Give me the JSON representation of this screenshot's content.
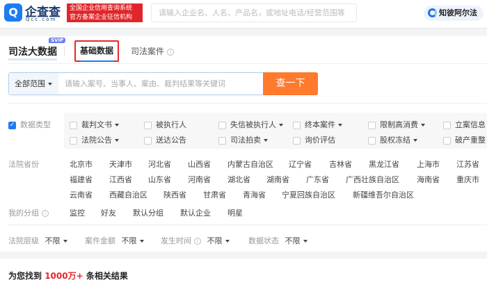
{
  "header": {
    "logo_icon": "qcc-logo-icon",
    "logo_text": "企查查",
    "logo_sub": "Qcc.com",
    "badge_line1": "全国企业信用查询系统",
    "badge_line2": "官方备案企业征信机构",
    "search_placeholder": "请输入企业名、人名、产品名，或地址电话/经营范围等",
    "ai_label": "知彼阿尔法"
  },
  "page": {
    "title": "司法大数据",
    "svip": "SVIP",
    "tabs": [
      {
        "label": "基础数据"
      },
      {
        "label": "司法案件"
      }
    ]
  },
  "search": {
    "scope": "全部范围",
    "placeholder": "请输入案号、当事人、案由、裁判结果等关键词",
    "button": "查一下"
  },
  "filters": {
    "data_type_label": "数据类型",
    "data_types": [
      {
        "label": "裁判文书",
        "dropdown": true
      },
      {
        "label": "被执行人",
        "dropdown": false
      },
      {
        "label": "失信被执行人",
        "dropdown": true
      },
      {
        "label": "终本案件",
        "dropdown": true
      },
      {
        "label": "限制高消费",
        "dropdown": true
      },
      {
        "label": "立案信息",
        "dropdown": false
      },
      {
        "label": "法院公告",
        "dropdown": true
      },
      {
        "label": "送达公告",
        "dropdown": false
      },
      {
        "label": "司法拍卖",
        "dropdown": true
      },
      {
        "label": "询价评估",
        "dropdown": false
      },
      {
        "label": "股权冻结",
        "dropdown": true
      },
      {
        "label": "破产重整",
        "dropdown": false
      }
    ],
    "province_label": "法院省份",
    "provinces": [
      "北京市",
      "天津市",
      "河北省",
      "山西省",
      "内蒙古自治区",
      "辽宁省",
      "吉林省",
      "黑龙江省",
      "上海市",
      "江苏省",
      "福建省",
      "江西省",
      "山东省",
      "河南省",
      "湖北省",
      "湖南省",
      "广东省",
      "广西壮族自治区",
      "海南省",
      "重庆市",
      "云南省",
      "西藏自治区",
      "陕西省",
      "甘肃省",
      "青海省",
      "宁夏回族自治区",
      "新疆维吾尔自治区"
    ],
    "group_label": "我的分组",
    "groups": [
      "监控",
      "好友",
      "默认分组",
      "默认企业",
      "明星"
    ],
    "selects": [
      {
        "label": "法院层级",
        "value": "不限"
      },
      {
        "label": "案件金额",
        "value": "不限"
      },
      {
        "label": "发生时间",
        "value": "不限"
      },
      {
        "label": "数据状态",
        "value": "不限"
      }
    ]
  },
  "result": {
    "prefix": "为您找到",
    "count": "1000万+",
    "suffix": "条相关结果"
  }
}
